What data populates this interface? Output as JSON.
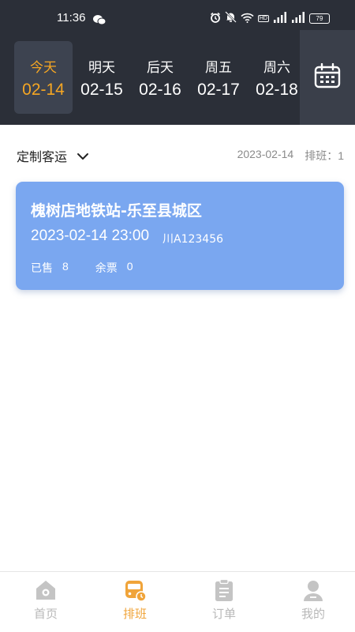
{
  "status_bar": {
    "time": "11:36",
    "battery": "79",
    "icons": [
      "wechat-icon",
      "alarm-icon",
      "mute-icon",
      "wifi-icon",
      "hd-icon",
      "signal-icon",
      "signal-icon",
      "battery-icon"
    ],
    "hd_label": "HD"
  },
  "dates": [
    {
      "day": "今天",
      "date": "02-14",
      "active": true
    },
    {
      "day": "明天",
      "date": "02-15",
      "active": false
    },
    {
      "day": "后天",
      "date": "02-16",
      "active": false
    },
    {
      "day": "周五",
      "date": "02-17",
      "active": false
    },
    {
      "day": "周六",
      "date": "02-18",
      "active": false
    }
  ],
  "calendar_icon": "calendar-icon",
  "filter": {
    "selected": "定制客运",
    "date": "2023-02-14",
    "count_label": "排班：",
    "count": "1"
  },
  "trip": {
    "route": "槐树店地铁站-乐至县城区",
    "datetime": "2023-02-14 23:00",
    "plate": "川A123456",
    "sold_label": "已售",
    "sold": "8",
    "remaining_label": "余票",
    "remaining": "0"
  },
  "tabs": [
    {
      "label": "首页",
      "icon": "home-icon",
      "active": false
    },
    {
      "label": "排班",
      "icon": "bus-schedule-icon",
      "active": true
    },
    {
      "label": "订单",
      "icon": "clipboard-icon",
      "active": false
    },
    {
      "label": "我的",
      "icon": "user-icon",
      "active": false
    }
  ],
  "colors": {
    "header_bg": "#2b2f38",
    "accent": "#f5a623",
    "card_bg": "#7aa7f0",
    "tab_active": "#f0a43a",
    "tab_inactive": "#b8b8b8"
  }
}
